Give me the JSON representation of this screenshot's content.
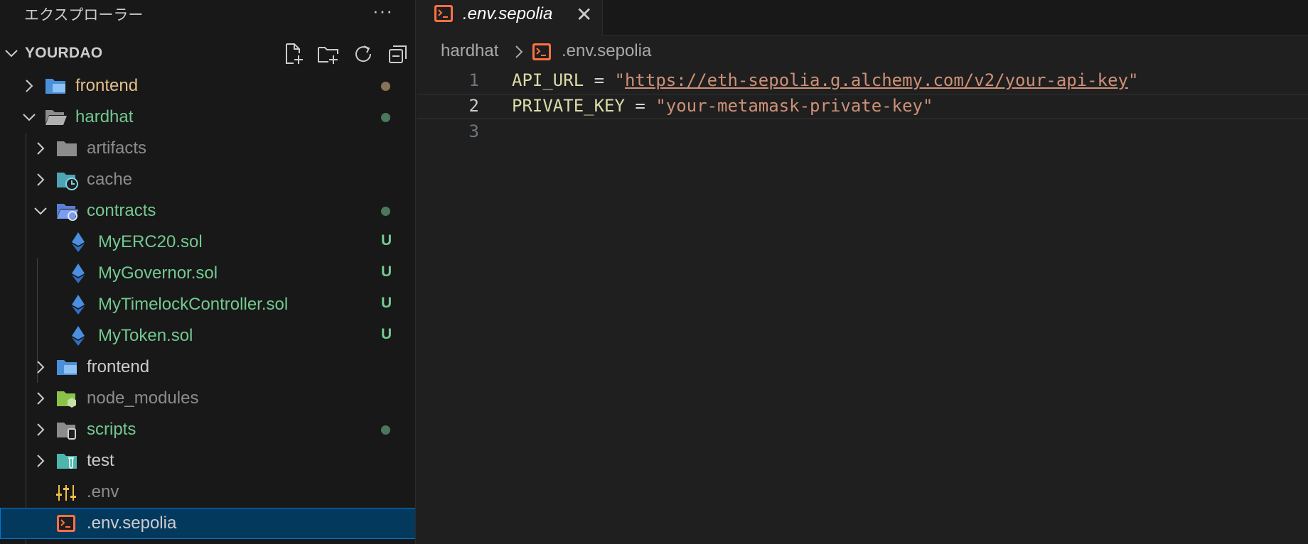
{
  "explorer": {
    "title": "エクスプローラー",
    "more": "···",
    "section_title": "YOURDAO",
    "actions": [
      "new-file-icon",
      "new-folder-icon",
      "refresh-icon",
      "collapse-all-icon"
    ]
  },
  "tree": [
    {
      "label": "frontend",
      "type": "folder",
      "expanded": false,
      "status": "modified-dot",
      "color": "#e2c08d",
      "icon": "folder-frontend-icon"
    },
    {
      "label": "hardhat",
      "type": "folder",
      "expanded": true,
      "status": "untracked-dot",
      "color": "#73c991",
      "icon": "folder-open-icon"
    },
    {
      "label": "artifacts",
      "type": "folder",
      "expanded": false,
      "status": "",
      "color": "#8c8c8c",
      "icon": "folder-icon"
    },
    {
      "label": "cache",
      "type": "folder",
      "expanded": false,
      "status": "",
      "color": "#8c8c8c",
      "icon": "folder-cache-icon"
    },
    {
      "label": "contracts",
      "type": "folder",
      "expanded": true,
      "status": "untracked-dot",
      "color": "#73c991",
      "icon": "folder-contracts-icon"
    },
    {
      "label": "MyERC20.sol",
      "type": "file",
      "status": "U",
      "color": "#73c991",
      "icon": "ethereum-icon"
    },
    {
      "label": "MyGovernor.sol",
      "type": "file",
      "status": "U",
      "color": "#73c991",
      "icon": "ethereum-icon"
    },
    {
      "label": "MyTimelockController.sol",
      "type": "file",
      "status": "U",
      "color": "#73c991",
      "icon": "ethereum-icon"
    },
    {
      "label": "MyToken.sol",
      "type": "file",
      "status": "U",
      "color": "#73c991",
      "icon": "ethereum-icon"
    },
    {
      "label": "frontend",
      "type": "folder",
      "expanded": false,
      "status": "",
      "color": "#cccccc",
      "icon": "folder-frontend-icon"
    },
    {
      "label": "node_modules",
      "type": "folder",
      "expanded": false,
      "status": "",
      "color": "#8c8c8c",
      "icon": "folder-node-icon"
    },
    {
      "label": "scripts",
      "type": "folder",
      "expanded": false,
      "status": "untracked-dot",
      "color": "#73c991",
      "icon": "folder-scripts-icon"
    },
    {
      "label": "test",
      "type": "folder",
      "expanded": false,
      "status": "",
      "color": "#cccccc",
      "icon": "folder-test-icon"
    },
    {
      "label": ".env",
      "type": "file",
      "status": "",
      "color": "#8c8c8c",
      "icon": "settings-sliders-icon"
    },
    {
      "label": ".env.sepolia",
      "type": "file",
      "status": "",
      "color": "#cccccc",
      "icon": "terminal-icon",
      "selected": true
    }
  ],
  "tab": {
    "label": ".env.sepolia",
    "close": "✕"
  },
  "breadcrumb": {
    "folder": "hardhat",
    "file": ".env.sepolia"
  },
  "editor": {
    "lines": [
      {
        "num": "1",
        "key": "API_URL",
        "eq": " = ",
        "q1": "\"",
        "value": "https://eth-sepolia.g.alchemy.com/v2/your-api-key",
        "q2": "\""
      },
      {
        "num": "2",
        "key": "PRIVATE_KEY",
        "eq": " = ",
        "q1": "\"",
        "value": "your-metamask-private-key",
        "q2": "\""
      },
      {
        "num": "3",
        "key": "",
        "eq": "",
        "q1": "",
        "value": "",
        "q2": ""
      }
    ],
    "current_line": 2
  },
  "colors": {
    "accent": "#0078d4",
    "modified": "#e2c08d",
    "untracked": "#73c991"
  }
}
